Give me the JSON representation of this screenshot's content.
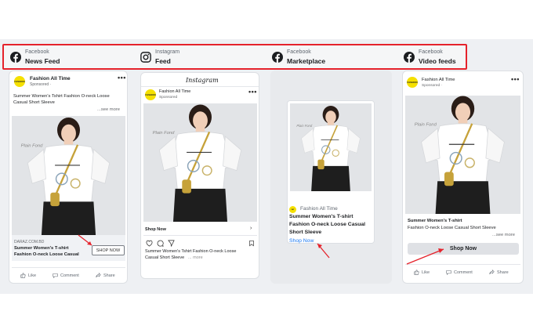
{
  "placements": [
    {
      "platform": "Facebook",
      "name": "News Feed",
      "icon": "facebook-icon"
    },
    {
      "platform": "Instagram",
      "name": "Feed",
      "icon": "instagram-icon"
    },
    {
      "platform": "Facebook",
      "name": "Marketplace",
      "icon": "facebook-icon"
    },
    {
      "platform": "Facebook",
      "name": "Video feeds",
      "icon": "facebook-icon"
    }
  ],
  "brand": "Fashion All Time",
  "sponsored": "Sponsored · ",
  "sponsored_plain": "Sponsored",
  "ad_text": {
    "line1": "Summer Women's Tshirt Fashion O-neck Loose",
    "line2": "Casual Short Sleeve"
  },
  "see_more": "...see more",
  "headline_feed": {
    "line1": "Summer Women's T-shirt",
    "line2": "Fashion O-neck Loose Casual"
  },
  "domain": "DARAZ.COM.BD",
  "shop_now_upper": "SHOP NOW",
  "shop_now": "Shop Now",
  "instagram_wordmark": "Instagram",
  "instagram_more": "... more",
  "marketplace_title": {
    "line1": "Summer Women's T-shirt",
    "line2": "Fashion O-neck Loose Casual",
    "line3": "Short Sleeve"
  },
  "video_headline": {
    "line1": "Summer Women's T-shirt",
    "line2": "Fashion O-neck Loose Casual Short Sleeve",
    "line3": "...see more"
  },
  "actions": {
    "like": "Like",
    "comment": "Comment",
    "share": "Share"
  },
  "colors": {
    "highlight": "#e5222b",
    "facebook": "#1c1e21",
    "link": "#1877f2",
    "logo": "#f5e000"
  }
}
